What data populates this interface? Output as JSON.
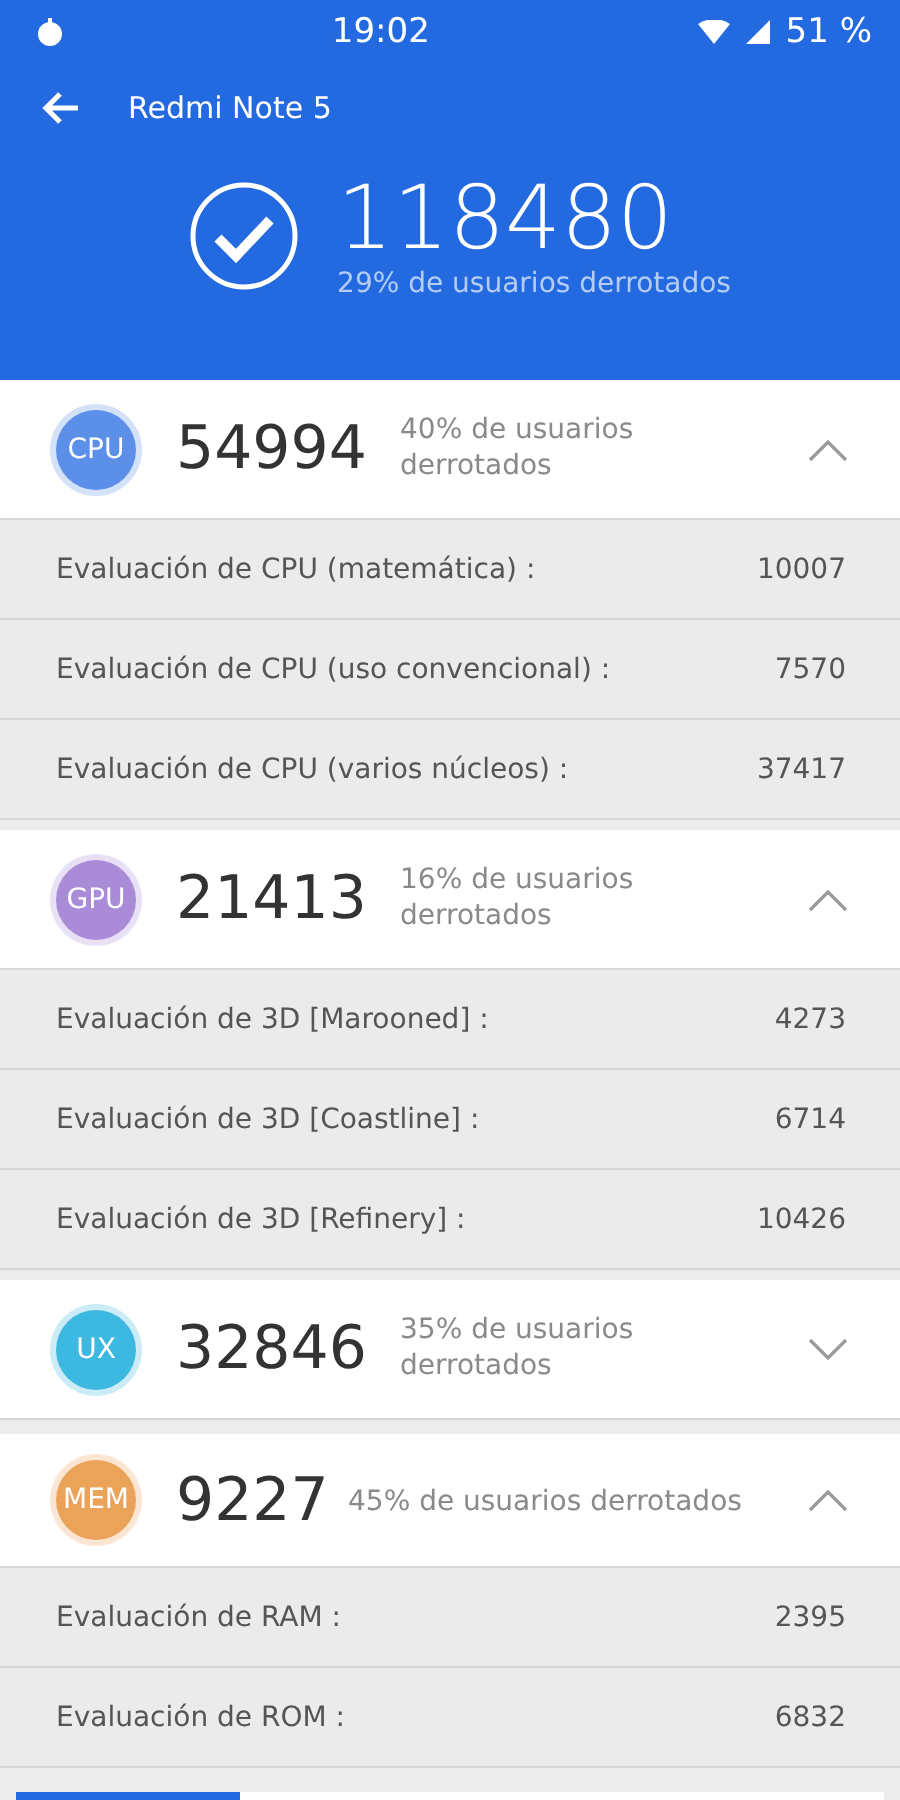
{
  "status_bar": {
    "time": "19:02",
    "battery": "51 %"
  },
  "header": {
    "title": "Redmi Note 5",
    "total_score": "118480",
    "total_note": "29% de usuarios derrotados"
  },
  "sections": [
    {
      "badge": "CPU",
      "color": "#5b8fe8",
      "score": "54994",
      "note": "40% de usuarios derrotados",
      "expanded": true,
      "rows": [
        {
          "label": "Evaluación de CPU (matemática) :",
          "value": "10007"
        },
        {
          "label": "Evaluación de CPU (uso convencional) :",
          "value": "7570"
        },
        {
          "label": "Evaluación de CPU (varios núcleos) :",
          "value": "37417"
        }
      ]
    },
    {
      "badge": "GPU",
      "color": "#a98bd8",
      "score": "21413",
      "note": "16% de usuarios derrotados",
      "expanded": true,
      "rows": [
        {
          "label": "Evaluación de 3D [Marooned] :",
          "value": "4273"
        },
        {
          "label": "Evaluación de 3D [Coastline] :",
          "value": "6714"
        },
        {
          "label": "Evaluación de 3D [Refinery] :",
          "value": "10426"
        }
      ]
    },
    {
      "badge": "UX",
      "color": "#3db8e0",
      "score": "32846",
      "note": "35% de usuarios derrotados",
      "expanded": false
    },
    {
      "badge": "MEM",
      "color": "#eba35a",
      "score": "9227",
      "note": "45% de usuarios derrotados",
      "expanded": true,
      "rows": [
        {
          "label": "Evaluación de RAM :",
          "value": "2395"
        },
        {
          "label": "Evaluación de ROM :",
          "value": "6832"
        }
      ]
    }
  ]
}
